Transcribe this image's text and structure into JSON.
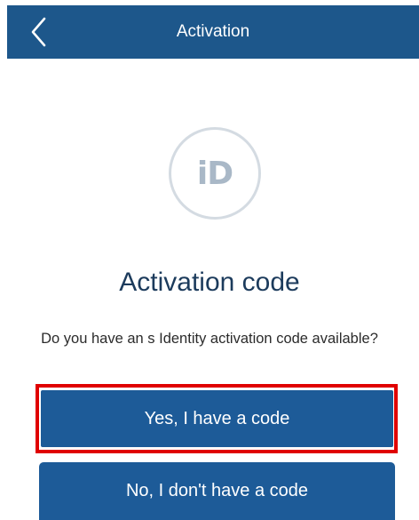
{
  "header": {
    "title": "Activation",
    "back_icon": "chevron-left-icon"
  },
  "logo": {
    "text": "iD"
  },
  "main": {
    "heading": "Activation code",
    "question": "Do you have an s Identity activation code available?"
  },
  "buttons": {
    "yes_label": "Yes, I have a code",
    "no_label": "No, I don't have a code"
  },
  "colors": {
    "header_bg": "#1d578b",
    "button_bg": "#1d5b98",
    "highlight_border": "#e00000",
    "heading_text": "#1c3b5c",
    "logo_ring": "#d4dbe2",
    "logo_text": "#a9b8c7"
  }
}
